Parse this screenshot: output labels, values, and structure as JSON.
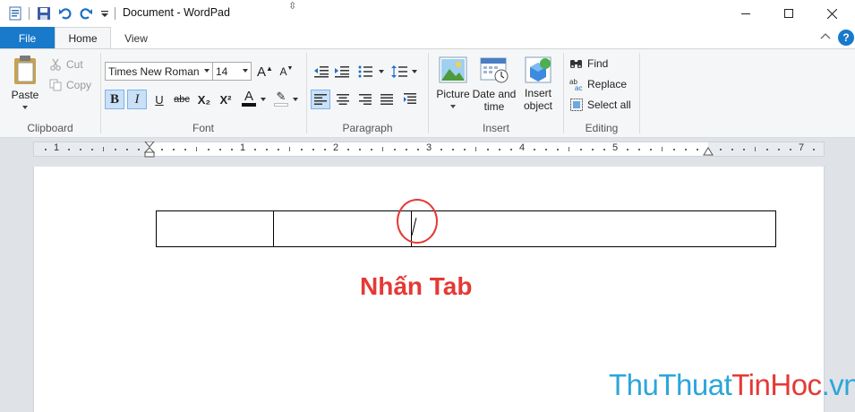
{
  "window": {
    "title": "Document - WordPad"
  },
  "tabs": {
    "file": "File",
    "home": "Home",
    "view": "View"
  },
  "clipboard": {
    "paste": "Paste",
    "cut": "Cut",
    "copy": "Copy",
    "label": "Clipboard"
  },
  "font": {
    "family": "Times New Roman",
    "size": "14",
    "label": "Font",
    "bold": "B",
    "italic": "I",
    "underline": "U",
    "strikethrough": "abc",
    "subscript": "X₂",
    "superscript": "X²",
    "font_color": "A",
    "highlight": "✎",
    "grow": "A",
    "shrink": "A"
  },
  "paragraph": {
    "label": "Paragraph"
  },
  "insert": {
    "picture": "Picture",
    "datetime_line1": "Date and",
    "datetime_line2": "time",
    "object_line1": "Insert",
    "object_line2": "object",
    "label": "Insert"
  },
  "editing": {
    "find": "Find",
    "replace": "Replace",
    "select_all": "Select all",
    "label": "Editing"
  },
  "ruler": {
    "numbers": [
      "1",
      "1",
      "2",
      "3",
      "4",
      "5",
      "7"
    ]
  },
  "document": {
    "annotation": "Nhấn Tab"
  },
  "watermark": {
    "part1": "ThuThuat",
    "part2": "TinHoc",
    "part3": ".vn"
  },
  "colors": {
    "accent": "#1979ca",
    "annotation": "#e53935",
    "watermark_blue": "#2ba6d9"
  }
}
